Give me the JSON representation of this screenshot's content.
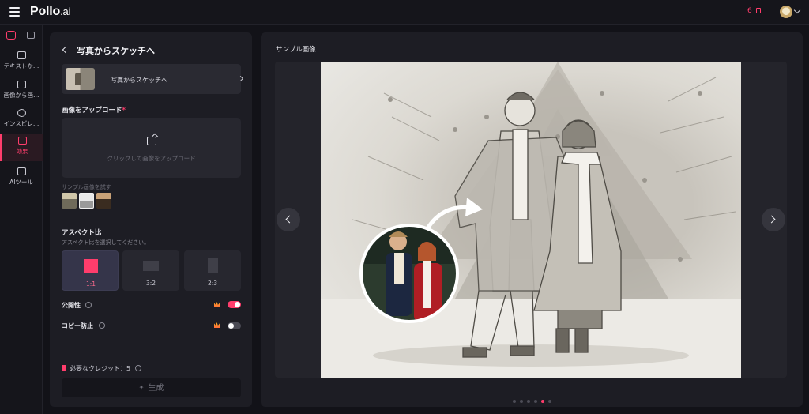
{
  "app": {
    "logo_main": "Pollo",
    "logo_suffix": ".ai",
    "credits": "6"
  },
  "sidenav": {
    "items": [
      {
        "label": "テキストか…",
        "icon": "text-to-image-icon"
      },
      {
        "label": "画像から画…",
        "icon": "image-to-image-icon"
      },
      {
        "label": "インスピレ…",
        "icon": "compass-icon"
      },
      {
        "label": "効果",
        "icon": "effects-icon",
        "active": true
      },
      {
        "label": "AIツール",
        "icon": "ai-tools-icon"
      }
    ]
  },
  "panel": {
    "title": "写真からスケッチへ",
    "tool_card_label": "写真からスケッチへ",
    "upload_title": "画像をアップロード",
    "upload_required_mark": "*",
    "upload_hint": "クリックして画像をアップロード",
    "sample_label": "サンプル画像を試す",
    "aspect_title": "アスペクト比",
    "aspect_subtitle": "アスペクト比を選択してください。",
    "aspect_options": [
      {
        "label": "1:1",
        "active": true
      },
      {
        "label": "3:2",
        "active": false
      },
      {
        "label": "2:3",
        "active": false
      }
    ],
    "public_label": "公開性",
    "public_on": true,
    "copy_protect_label": "コピー防止",
    "copy_protect_on": false,
    "required_credits_label": "必要なクレジット：",
    "required_credits_value": "5",
    "generate_label": "生成"
  },
  "preview": {
    "title": "サンプル画像",
    "dot_count": 6,
    "active_dot": 4
  },
  "colors": {
    "accent": "#ff3d6c",
    "background": "#121218",
    "panel": "#1d1d24"
  }
}
